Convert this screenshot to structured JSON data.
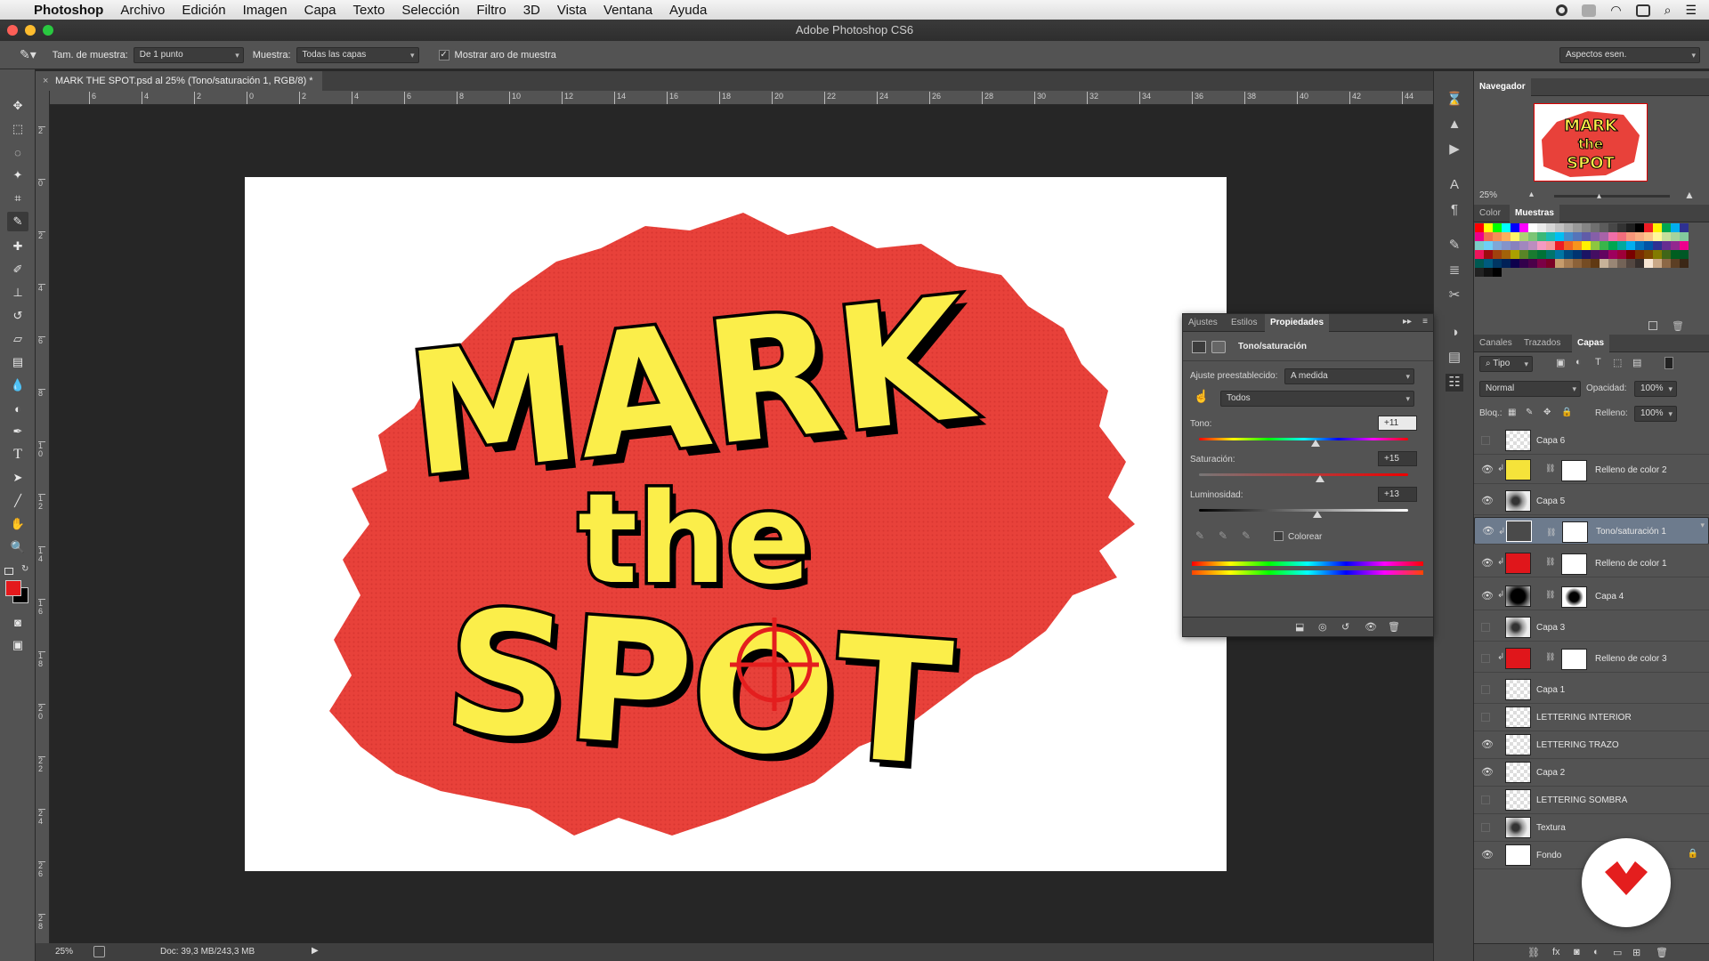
{
  "menubar": {
    "app": "Photoshop",
    "items": [
      "Archivo",
      "Edición",
      "Imagen",
      "Capa",
      "Texto",
      "Selección",
      "Filtro",
      "3D",
      "Vista",
      "Ventana",
      "Ayuda"
    ]
  },
  "window": {
    "title": "Adobe Photoshop CS6"
  },
  "options": {
    "sample_size_label": "Tam. de muestra:",
    "sample_size_value": "De 1 punto",
    "sample_label": "Muestra:",
    "sample_value": "Todas las capas",
    "show_ring_label": "Mostrar aro de muestra",
    "workspace_value": "Aspectos esen."
  },
  "document": {
    "tab_title": "MARK THE SPOT.psd al 25% (Tono/saturación 1, RGB/8) *",
    "artwork_line1": "MARK",
    "artwork_line2": "the",
    "artwork_line3": "SPOT"
  },
  "rulers": {
    "top": [
      "6",
      "4",
      "2",
      "0",
      "2",
      "4",
      "6",
      "8",
      "10",
      "12",
      "14",
      "16",
      "18",
      "20",
      "22",
      "24",
      "26",
      "28",
      "30",
      "32",
      "34",
      "36",
      "38",
      "40",
      "42",
      "44"
    ],
    "left": [
      "2",
      "0",
      "2",
      "4",
      "6",
      "8",
      "1 0",
      "1 2",
      "1 4",
      "1 6",
      "1 8",
      "2 0",
      "2 2",
      "2 4",
      "2 6",
      "2 8"
    ]
  },
  "status": {
    "zoom": "25%",
    "doc": "Doc: 39,3 MB/243,3 MB"
  },
  "navigator": {
    "tab": "Navegador",
    "zoom": "25%"
  },
  "color_panel": {
    "tabs": [
      "Color",
      "Muestras"
    ],
    "active": "Muestras"
  },
  "layers_panel": {
    "tabs": [
      "Canales",
      "Trazados",
      "Capas"
    ],
    "active": "Capas",
    "filter": "Tipo",
    "blend_mode": "Normal",
    "opacity_label": "Opacidad:",
    "opacity": "100%",
    "lock_label": "Bloq.:",
    "fill_label": "Relleno:",
    "fill": "100%",
    "layers": [
      {
        "name": "Capa 6",
        "visible": false,
        "thumb": "checker"
      },
      {
        "name": "Relleno de color 2",
        "visible": true,
        "thumb": "#f5e33a",
        "mask": true
      },
      {
        "name": "Capa 5",
        "visible": true,
        "thumb": "texture"
      },
      {
        "name": "Tono/saturación 1",
        "visible": true,
        "thumb": "adjust",
        "mask": true,
        "selected": true
      },
      {
        "name": "Relleno de color 1",
        "visible": true,
        "thumb": "#e0161b",
        "mask": true
      },
      {
        "name": "Capa 4",
        "visible": true,
        "thumb": "texture-dark",
        "mask": true
      },
      {
        "name": "Capa 3",
        "visible": false,
        "thumb": "texture"
      },
      {
        "name": "Relleno de color 3",
        "visible": false,
        "thumb": "#e0161b",
        "mask": true
      },
      {
        "name": "Capa 1",
        "visible": false,
        "thumb": "checker"
      },
      {
        "name": "LETTERING INTERIOR",
        "visible": false,
        "thumb": "checker"
      },
      {
        "name": "LETTERING TRAZO",
        "visible": true,
        "thumb": "checker"
      },
      {
        "name": "Capa 2",
        "visible": true,
        "thumb": "checker"
      },
      {
        "name": "LETTERING SOMBRA",
        "visible": false,
        "thumb": "checker"
      },
      {
        "name": "Textura",
        "visible": false,
        "thumb": "texture"
      },
      {
        "name": "Fondo",
        "visible": true,
        "thumb": "#ffffff",
        "locked": true
      }
    ]
  },
  "properties": {
    "tabs": [
      "Ajustes",
      "Estilos",
      "Propiedades"
    ],
    "active": "Propiedades",
    "header": "Tono/saturación",
    "preset_label": "Ajuste preestablecido:",
    "preset_value": "A medida",
    "channel_value": "Todos",
    "hue_label": "Tono:",
    "hue_value": "+11",
    "sat_label": "Saturación:",
    "sat_value": "+15",
    "light_label": "Luminosidad:",
    "light_value": "+13",
    "colorize_label": "Colorear"
  },
  "colors": {
    "foreground": "#e4191c",
    "background": "#000000",
    "brand_red": "#e41e1e",
    "art_red": "#e8413a",
    "art_yellow": "#fbee4a"
  }
}
